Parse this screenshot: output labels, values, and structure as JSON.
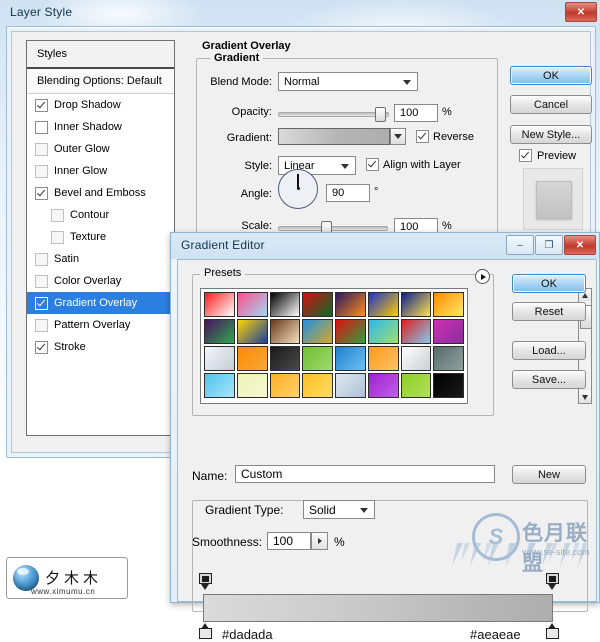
{
  "layer_style": {
    "title": "Layer Style",
    "close_label": "✕",
    "styles_panel": {
      "header": "Styles",
      "blending_options": "Blending Options: Default",
      "items": [
        {
          "label": "Drop Shadow",
          "checked": true,
          "enabled": true,
          "indent": false
        },
        {
          "label": "Inner Shadow",
          "checked": false,
          "enabled": true,
          "indent": false
        },
        {
          "label": "Outer Glow",
          "checked": false,
          "enabled": false,
          "indent": false
        },
        {
          "label": "Inner Glow",
          "checked": false,
          "enabled": false,
          "indent": false
        },
        {
          "label": "Bevel and Emboss",
          "checked": true,
          "enabled": true,
          "indent": false
        },
        {
          "label": "Contour",
          "checked": false,
          "enabled": false,
          "indent": true
        },
        {
          "label": "Texture",
          "checked": false,
          "enabled": false,
          "indent": true
        },
        {
          "label": "Satin",
          "checked": false,
          "enabled": false,
          "indent": false
        },
        {
          "label": "Color Overlay",
          "checked": false,
          "enabled": false,
          "indent": false
        },
        {
          "label": "Gradient Overlay",
          "checked": true,
          "enabled": true,
          "indent": false,
          "selected": true
        },
        {
          "label": "Pattern Overlay",
          "checked": false,
          "enabled": false,
          "indent": false
        },
        {
          "label": "Stroke",
          "checked": true,
          "enabled": true,
          "indent": false
        }
      ]
    },
    "panel": {
      "section_title": "Gradient Overlay",
      "group_title": "Gradient",
      "blend_mode_label": "Blend Mode:",
      "blend_mode_value": "Normal",
      "opacity_label": "Opacity:",
      "opacity_value": "100",
      "opacity_unit": "%",
      "gradient_label": "Gradient:",
      "reverse_label": "Reverse",
      "reverse_checked": true,
      "style_label": "Style:",
      "style_value": "Linear",
      "align_label": "Align with Layer",
      "align_checked": true,
      "angle_label": "Angle:",
      "angle_value": "90",
      "angle_unit": "°",
      "scale_label": "Scale:",
      "scale_value": "100",
      "scale_unit": "%"
    },
    "buttons": {
      "ok": "OK",
      "cancel": "Cancel",
      "new_style": "New Style...",
      "preview_label": "Preview",
      "preview_checked": true
    }
  },
  "gradient_editor": {
    "title": "Gradient Editor",
    "minimize_label": "–",
    "maximize_label": "❐",
    "close_label": "✕",
    "presets_label": "Presets",
    "buttons": {
      "ok": "OK",
      "reset": "Reset",
      "load": "Load...",
      "save": "Save...",
      "new": "New"
    },
    "name_label": "Name:",
    "name_value": "Custom",
    "gradient_type_label": "Gradient Type:",
    "gradient_type_value": "Solid",
    "smoothness_label": "Smoothness:",
    "smoothness_value": "100",
    "smoothness_unit": "%",
    "stops": {
      "left_hex": "#dadada",
      "right_hex": "#aeaeae"
    },
    "presets_swatches": [
      [
        "#ff1a1a",
        "#ffffff"
      ],
      [
        "#ff4d8a",
        "#9fd8f5"
      ],
      [
        "#000000",
        "#ffffff"
      ],
      [
        "#d10f0f",
        "#0a6b2a"
      ],
      [
        "#2b1a5e",
        "#ff8c1a"
      ],
      [
        "#1a33cc",
        "#ffcc00"
      ],
      [
        "#0d1f8f",
        "#ffe14d"
      ],
      [
        "#ff8c00",
        "#ffe866"
      ],
      [
        "#4b1060",
        "#2fa84f"
      ],
      [
        "#ffd400",
        "#1a3fa0"
      ],
      [
        "#6b3a1a",
        "#f2e0c2"
      ],
      [
        "#1f8fe0",
        "#d8a82a"
      ],
      [
        "#e01010",
        "#2f9f3f"
      ],
      [
        "#2bb6f0",
        "#9fe06b"
      ],
      [
        "#e02020",
        "#7fc9f0"
      ],
      [
        "#cf2fb0",
        "#8a2f9f"
      ],
      [
        "#f2f6fa",
        "#c4ccd4"
      ],
      [
        "#ff8a00",
        "#f5a83a"
      ],
      [
        "#1a1a1a",
        "#4a4a4a"
      ],
      [
        "#6fbf2f",
        "#9fd96f"
      ],
      [
        "#1f7fd0",
        "#6fc0f0"
      ],
      [
        "#ff9a1a",
        "#ffc266"
      ],
      [
        "#ffffff",
        "#c9cfd4"
      ],
      [
        "#5a6b6b",
        "#8fa0a0"
      ],
      [
        "#4fc4f0",
        "#a8e4f8"
      ],
      [
        "#eef2b8",
        "#f5f8d0"
      ],
      [
        "#ffb020",
        "#ffd070"
      ],
      [
        "#ffc020",
        "#ffdb66"
      ],
      [
        "#dfe8f2",
        "#aebfd4"
      ],
      [
        "#a020d0",
        "#c060e8"
      ],
      [
        "#8fd020",
        "#b0e060"
      ],
      [
        "#000000",
        "#1a1a1a"
      ]
    ]
  },
  "watermark": {
    "logo_text": "夕木木",
    "logo_url": "www.ximumu.cn",
    "site_mark": "S",
    "site_cn": "色月联盟",
    "site_domain": "www.se-site.com"
  }
}
